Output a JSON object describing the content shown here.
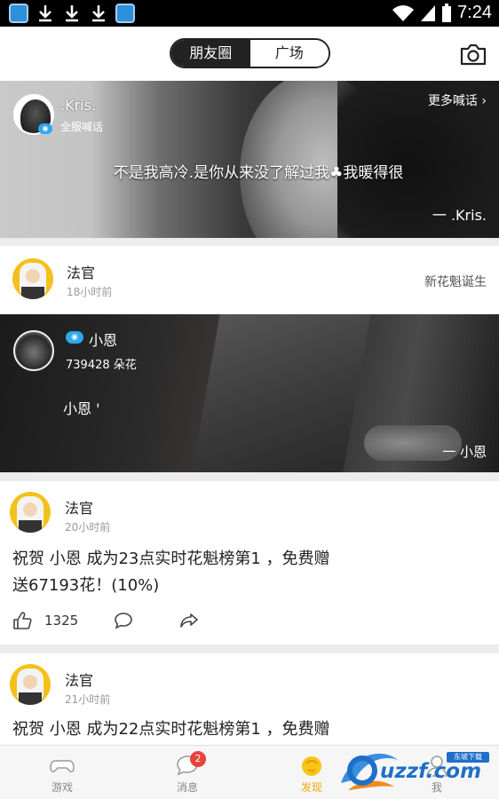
{
  "status_bar": {
    "time": "7:24",
    "notification_icons": [
      "app-icon",
      "download-icon",
      "download-icon",
      "download-icon",
      "app-icon"
    ],
    "system_icons": [
      "wifi-icon",
      "signal-icon",
      "battery-icon"
    ]
  },
  "header": {
    "tabs": [
      {
        "label": "朋友圈",
        "active": true
      },
      {
        "label": "广场",
        "active": false
      }
    ],
    "camera_icon": "camera-icon"
  },
  "banner": {
    "user_name": ".Kris.",
    "subtitle": "全服喊话",
    "more_label": "更多喊话",
    "quote": "不是我高冷.是你从来没了解过我♣我暖得很",
    "signature": "一 .Kris."
  },
  "post1": {
    "author": "法官",
    "time": "18小时前",
    "tag": "新花魁诞生"
  },
  "photo_card": {
    "name": "小恩",
    "flowers": "739428 朵花",
    "text": "小恩 '",
    "signature": "一 小恩"
  },
  "post2": {
    "author": "法官",
    "time": "20小时前",
    "text_line1": "祝贺 小恩 成为23点实时花魁榜第1 ，免费赠",
    "text_line2": "送67193花！(10%)",
    "like_count": "1325"
  },
  "post3": {
    "author": "法官",
    "time": "21小时前",
    "text_line1": "祝贺 小恩 成为22点实时花魁榜第1 ，免费赠"
  },
  "bottom_nav": {
    "items": [
      {
        "label": "游戏",
        "icon": "gamepad-icon"
      },
      {
        "label": "消息",
        "icon": "chat-bubble-icon",
        "badge": "2"
      },
      {
        "label": "发现",
        "icon": "discover-icon",
        "active": true
      },
      {
        "label": "我",
        "icon": "profile-icon"
      }
    ]
  },
  "watermark": {
    "text": "uzzf.com",
    "tag": "东坡下载"
  },
  "colors": {
    "accent": "#f0a800",
    "vip_blue": "#2fa8ef",
    "badge_red": "#e8423c"
  }
}
